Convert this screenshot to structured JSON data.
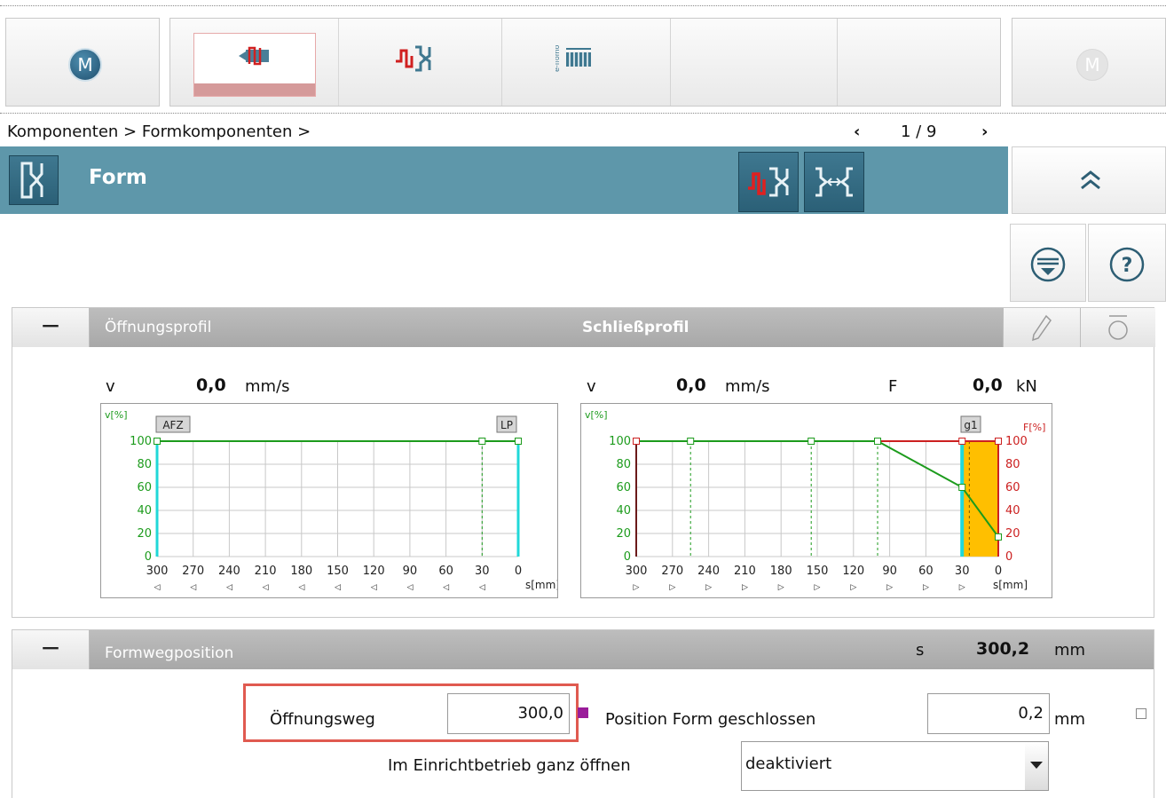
{
  "toolbar": {
    "left_button": "M",
    "right_button": "M",
    "tabs": [
      {
        "name": "injection-unit"
      },
      {
        "name": "mold"
      },
      {
        "name": "e-flomo"
      }
    ]
  },
  "breadcrumb": "Komponenten > Formkomponenten >",
  "pager": {
    "text": "1 / 9"
  },
  "header": {
    "title": "Form"
  },
  "profile_panel": {
    "tab_open": "Öffnungsprofil",
    "tab_close": "Schließprofil",
    "left": {
      "v_label": "v",
      "v_value": "0,0",
      "v_unit": "mm/s",
      "y_axis_label": "v[%]",
      "marker_left": "AFZ",
      "marker_right": "LP",
      "x_ticks": [
        "300",
        "270",
        "240",
        "210",
        "180",
        "150",
        "120",
        "90",
        "60",
        "30",
        "0"
      ],
      "x_unit": "s[mm]",
      "y_ticks": [
        "100",
        "80",
        "60",
        "40",
        "20",
        "0"
      ]
    },
    "right": {
      "v_label": "v",
      "v_value": "0,0",
      "v_unit": "mm/s",
      "f_label": "F",
      "f_value": "0,0",
      "f_unit": "kN",
      "y_axis_label": "v[%]",
      "y2_axis_label": "F[%]",
      "marker": "g1",
      "x_ticks": [
        "300",
        "270",
        "240",
        "210",
        "180",
        "150",
        "120",
        "90",
        "60",
        "30",
        "0"
      ],
      "x_unit": "s[mm]",
      "y_ticks": [
        "100",
        "80",
        "60",
        "40",
        "20",
        "0"
      ]
    }
  },
  "chart_data": [
    {
      "type": "line",
      "x": [
        300,
        30,
        0
      ],
      "series": [
        {
          "values": [
            100,
            100,
            100
          ]
        }
      ],
      "xlim": [
        300,
        0
      ],
      "ylim": [
        0,
        100
      ],
      "xlabel": "s[mm]",
      "ylabel": "v[%]"
    },
    {
      "type": "line",
      "x": [
        300,
        255,
        155,
        100,
        30,
        0
      ],
      "series": [
        {
          "values": [
            100,
            100,
            100,
            100,
            60,
            17
          ]
        },
        {
          "values": [
            100,
            100,
            100,
            100,
            100,
            100
          ]
        }
      ],
      "xlim": [
        300,
        0
      ],
      "ylim": [
        0,
        100
      ],
      "xlabel": "s[mm]",
      "ylabel": "v[%]",
      "y2label": "F[%]"
    }
  ],
  "position_panel": {
    "title": "Formwegposition",
    "s_label": "s",
    "s_value": "300,2",
    "s_unit": "mm",
    "opening_label": "Öffnungsweg",
    "opening_value": "300,0",
    "closed_label": "Position Form geschlossen",
    "closed_value": "0,2",
    "closed_unit": "mm",
    "setup_label": "Im Einrichtbetrieb ganz öffnen",
    "setup_value": "deaktiviert"
  },
  "colors": {
    "header": "#5e97aa",
    "green": "#1c9b1c",
    "red": "#cc2020",
    "cyan": "#20d8d8",
    "orange": "#ffbf00",
    "highlight": "#e05a50"
  }
}
